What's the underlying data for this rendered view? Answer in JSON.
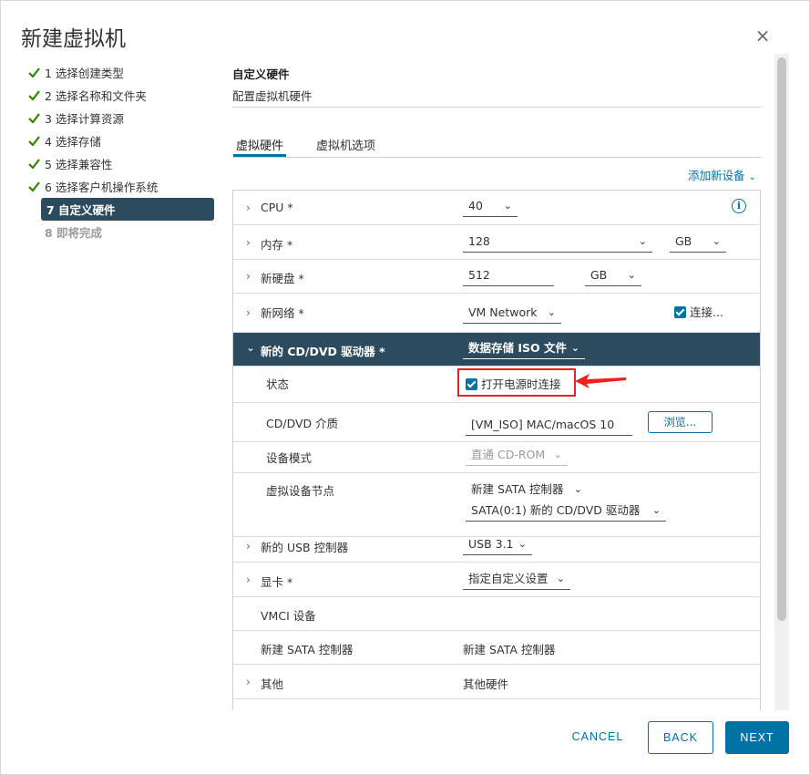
{
  "dialog": {
    "title": "新建虚拟机",
    "close_glyph": "×"
  },
  "steps": [
    {
      "label": "1 选择创建类型",
      "state": "done"
    },
    {
      "label": "2 选择名称和文件夹",
      "state": "done"
    },
    {
      "label": "3 选择计算资源",
      "state": "done"
    },
    {
      "label": "4 选择存储",
      "state": "done"
    },
    {
      "label": "5 选择兼容性",
      "state": "done"
    },
    {
      "label": "6 选择客户机操作系统",
      "state": "done"
    },
    {
      "label": "7 自定义硬件",
      "state": "active"
    },
    {
      "label": "8 即将完成",
      "state": "disabled"
    }
  ],
  "section": {
    "title": "自定义硬件",
    "subtitle": "配置虚拟机硬件"
  },
  "tabs": [
    {
      "label": "虚拟硬件",
      "active": true
    },
    {
      "label": "虚拟机选项",
      "active": false
    }
  ],
  "add_device": "添加新设备",
  "hardware": {
    "cpu": {
      "label": "CPU *",
      "value": "40"
    },
    "memory": {
      "label": "内存 *",
      "value": "128",
      "unit": "GB"
    },
    "disk": {
      "label": "新硬盘 *",
      "value": "512",
      "unit": "GB"
    },
    "network": {
      "label": "新网络 *",
      "value": "VM Network",
      "connect_label": "连接..."
    },
    "cddvd": {
      "label": "新的 CD/DVD 驱动器 *",
      "value": "数据存储 ISO 文件",
      "status_label": "状态",
      "status_value": "打开电源时连接",
      "media_label": "CD/DVD 介质",
      "media_value": "[VM_ISO] MAC/macOS 10",
      "browse_label": "浏览...",
      "mode_label": "设备模式",
      "mode_value": "直通 CD-ROM",
      "node_label": "虚拟设备节点",
      "node_controller": "新建 SATA 控制器",
      "node_value": "SATA(0:1) 新的 CD/DVD 驱动器"
    },
    "usb": {
      "label": "新的 USB 控制器",
      "value": "USB 3.1"
    },
    "video": {
      "label": "显卡 *",
      "value": "指定自定义设置"
    },
    "vmci": {
      "label": "VMCI 设备"
    },
    "sata": {
      "label": "新建 SATA 控制器",
      "value": "新建 SATA 控制器"
    },
    "other": {
      "label": "其他",
      "value": "其他硬件"
    }
  },
  "footer": {
    "cancel": "CANCEL",
    "back": "BACK",
    "next": "NEXT"
  },
  "colors": {
    "accent": "#0072a3",
    "header_dark": "#2d4b5e",
    "check_green": "#2f8400",
    "annotation_red": "#e8231c"
  }
}
